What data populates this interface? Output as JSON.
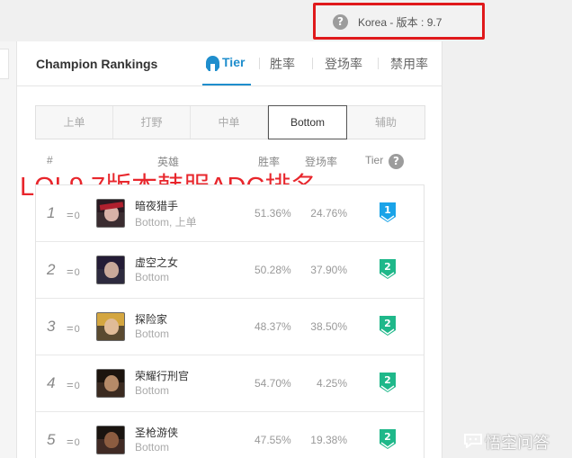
{
  "region_version": {
    "text": "Korea - 版本 : 9.7"
  },
  "panel": {
    "title": "Champion Rankings",
    "tabs": [
      {
        "label": "Tier",
        "active": true
      },
      {
        "label": "胜率",
        "active": false
      },
      {
        "label": "登场率",
        "active": false
      },
      {
        "label": "禁用率",
        "active": false
      }
    ]
  },
  "positions": [
    {
      "label": "上单",
      "active": false
    },
    {
      "label": "打野",
      "active": false
    },
    {
      "label": "中单",
      "active": false
    },
    {
      "label": "Bottom",
      "active": true
    },
    {
      "label": "辅助",
      "active": false
    }
  ],
  "columns": {
    "rank": "#",
    "champion": "英雄",
    "winrate": "胜率",
    "pickrate": "登场率",
    "tier": "Tier"
  },
  "overlay_title": "LOL9.7版本韩服ADC排名",
  "rows": [
    {
      "rank": "1",
      "delta": "0",
      "name": "暗夜猎手",
      "positions": "Bottom, 上单",
      "winrate": "51.36%",
      "pickrate": "24.76%",
      "tier": "1",
      "tier_color": "#1aa3e8"
    },
    {
      "rank": "2",
      "delta": "0",
      "name": "虚空之女",
      "positions": "Bottom",
      "winrate": "50.28%",
      "pickrate": "37.90%",
      "tier": "2",
      "tier_color": "#1fb88a"
    },
    {
      "rank": "3",
      "delta": "0",
      "name": "探险家",
      "positions": "Bottom",
      "winrate": "48.37%",
      "pickrate": "38.50%",
      "tier": "2",
      "tier_color": "#1fb88a"
    },
    {
      "rank": "4",
      "delta": "0",
      "name": "荣耀行刑官",
      "positions": "Bottom",
      "winrate": "54.70%",
      "pickrate": "4.25%",
      "tier": "2",
      "tier_color": "#1fb88a"
    },
    {
      "rank": "5",
      "delta": "0",
      "name": "圣枪游侠",
      "positions": "Bottom",
      "winrate": "47.55%",
      "pickrate": "19.38%",
      "tier": "2",
      "tier_color": "#1fb88a"
    }
  ],
  "watermark": "悟空问答",
  "colors": {
    "accent": "#1f8ecd",
    "highlight_border": "#e0191b",
    "overlay_text": "#e8262c"
  }
}
